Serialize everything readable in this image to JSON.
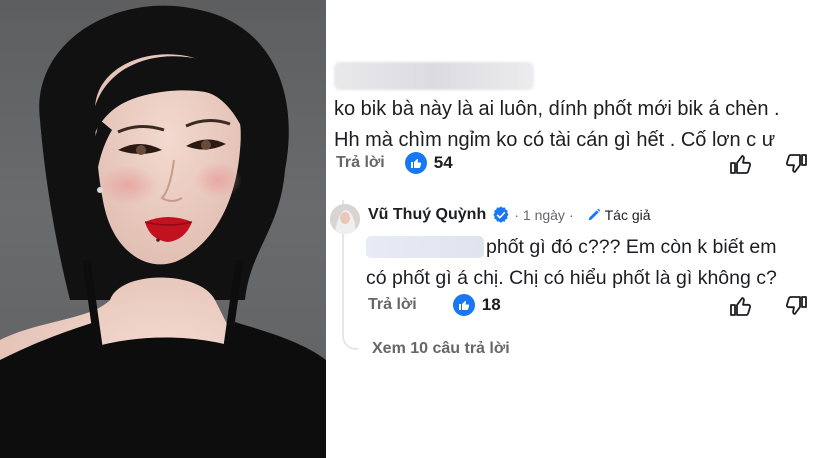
{
  "comment": {
    "line1": "ko bik bà này là ai luôn, dính phốt mới bik á chèn .",
    "line2": "Hh mà chìm ngỉm ko có tài cán gì hết . Cố lơn c ư",
    "reply_label": "Trả lời",
    "like_count": "54"
  },
  "reply": {
    "author": "Vũ Thuý Quỳnh",
    "time": "1 ngày",
    "separator": "·",
    "author_tag": "Tác giả",
    "line1": "phốt gì đó c??? Em còn k biết em",
    "line2": "có phốt gì á chị. Chị có hiểu phốt là gì không c?",
    "reply_label": "Trả lời",
    "like_count": "18"
  },
  "view_replies": "Xem 10 câu trả lời",
  "colors": {
    "link_gray": "#65676b",
    "text": "#1c1e21",
    "like_blue": "#1877f2",
    "lipstick": "#c3121f"
  },
  "icons": [
    "thumbs-up-icon",
    "upvote-icon",
    "downvote-icon",
    "verified-badge-icon",
    "pencil-icon"
  ]
}
